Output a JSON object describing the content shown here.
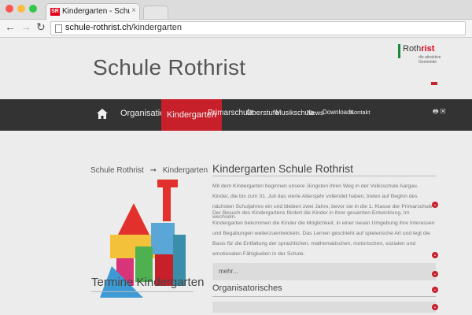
{
  "browser": {
    "tab_title": "Kindergarten - Schule Roth",
    "tab_favicon_text": "SR",
    "url_host": "schule-rothrist.ch",
    "url_path": "/kindergarten"
  },
  "site": {
    "title": "Schule Rothrist",
    "logo": {
      "name_plain": "Roth",
      "name_accent": "rist",
      "tagline": "die attraktive Gemeinde"
    }
  },
  "nav": {
    "items": [
      {
        "label": "Organisation",
        "active": false
      },
      {
        "label": "Kindergarten",
        "active": true
      },
      {
        "label": "Primarschule",
        "active": false
      },
      {
        "label": "Oberstufe",
        "active": false
      },
      {
        "label": "Musikschule",
        "active": false
      },
      {
        "label": "News",
        "active": false
      },
      {
        "label": "Downloads",
        "active": false
      },
      {
        "label": "Kontakt",
        "active": false
      }
    ]
  },
  "breadcrumb": {
    "root": "Schule Rothrist",
    "separator": "➞",
    "current": "Kindergarten"
  },
  "main": {
    "heading": "Kindergarten Schule Rothrist",
    "paragraph1": "Mit dem Kindergarten beginnen unsere Jüngsten ihren Weg in der Volksschule Aargau. Kinder, die bis zum 31. Juli das vierte Altersjahr vollendet haben, treten auf Beginn des nächsten Schuljahres ein und bleiben zwei Jahre, bevor sie in die 1. Klasse der Primarschule wechseln.",
    "paragraph2": "Der Besuch des Kindergartens fördert die Kinder in ihrer gesamten Entwicklung. Im Kindergarten bekommen die Kinder die Möglichkeit, in einer neuen Umgebung ihre Interessen und Begabungen weiterzuentwickeln. Das Lernen geschieht auf spielerische Art und legt die Basis für die Entfaltung der sprachlichen, mathematischen, motorischen, sozialen und emotionalen Fähigkeiten in der Schule.",
    "more_label": "mehr...",
    "section2_heading": "Organisatorisches"
  },
  "left": {
    "heading": "Termine Kindergarten"
  },
  "colors": {
    "accent": "#c8202b",
    "navbar": "#333333"
  }
}
